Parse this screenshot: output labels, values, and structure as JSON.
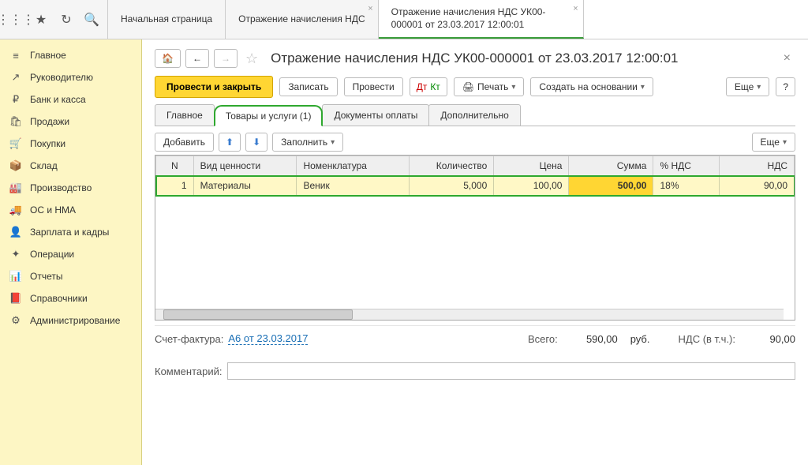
{
  "topTabs": [
    {
      "label": "Начальная страница",
      "closable": false
    },
    {
      "label": "Отражение начисления НДС",
      "closable": true
    },
    {
      "label": "Отражение начисления НДС УК00-000001 от 23.03.2017 12:00:01",
      "closable": true,
      "active": true
    }
  ],
  "sidebar": {
    "items": [
      {
        "label": "Главное",
        "icon": "≡"
      },
      {
        "label": "Руководителю",
        "icon": "↗"
      },
      {
        "label": "Банк и касса",
        "icon": "₽"
      },
      {
        "label": "Продажи",
        "icon": "🛍"
      },
      {
        "label": "Покупки",
        "icon": "🛒"
      },
      {
        "label": "Склад",
        "icon": "📦"
      },
      {
        "label": "Производство",
        "icon": "🏭"
      },
      {
        "label": "ОС и НМА",
        "icon": "🚚"
      },
      {
        "label": "Зарплата и кадры",
        "icon": "👤"
      },
      {
        "label": "Операции",
        "icon": "✦"
      },
      {
        "label": "Отчеты",
        "icon": "📊"
      },
      {
        "label": "Справочники",
        "icon": "📕"
      },
      {
        "label": "Администрирование",
        "icon": "⚙"
      }
    ]
  },
  "header": {
    "title": "Отражение начисления НДС УК00-000001 от 23.03.2017 12:00:01"
  },
  "cmdbar": {
    "primary": "Провести и закрыть",
    "save": "Записать",
    "post": "Провести",
    "print": "Печать",
    "createBased": "Создать на основании",
    "more": "Еще",
    "help": "?"
  },
  "innerTabs": [
    {
      "label": "Главное"
    },
    {
      "label": "Товары и услуги (1)",
      "active": true
    },
    {
      "label": "Документы оплаты"
    },
    {
      "label": "Дополнительно"
    }
  ],
  "tblToolbar": {
    "add": "Добавить",
    "fill": "Заполнить",
    "more": "Еще"
  },
  "table": {
    "headers": [
      "N",
      "Вид ценности",
      "Номенклатура",
      "Количество",
      "Цена",
      "Сумма",
      "% НДС",
      "НДС"
    ],
    "rows": [
      {
        "n": "1",
        "type": "Материалы",
        "item": "Веник",
        "qty": "5,000",
        "price": "100,00",
        "sum": "500,00",
        "vatPct": "18%",
        "vat": "90,00"
      }
    ]
  },
  "footer": {
    "invoiceLabel": "Счет-фактура:",
    "invoiceLink": "А6 от 23.03.2017",
    "totalLabel": "Всего:",
    "totalValue": "590,00",
    "currency": "руб.",
    "vatInclLabel": "НДС (в т.ч.):",
    "vatInclValue": "90,00",
    "commentLabel": "Комментарий:"
  }
}
